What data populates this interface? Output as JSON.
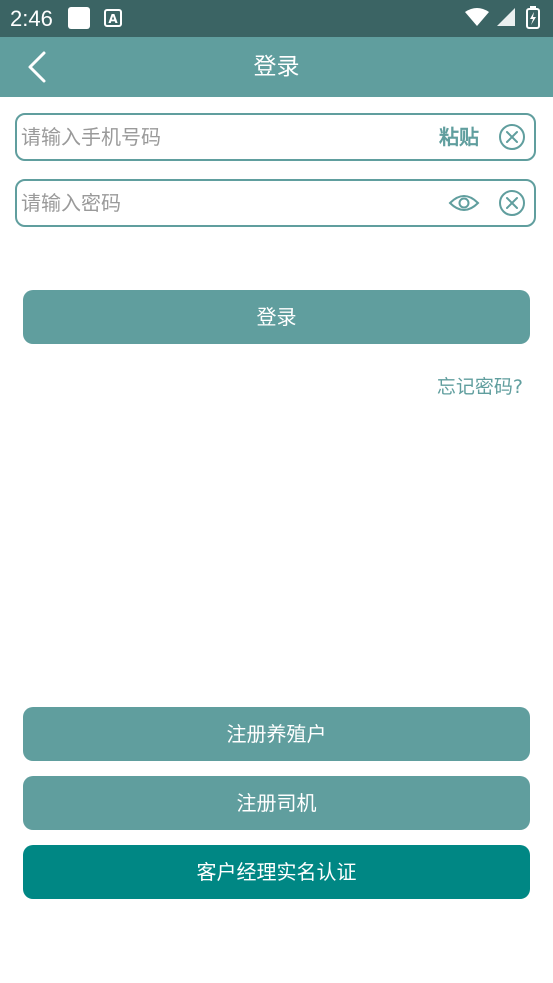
{
  "status_bar": {
    "time": "2:46",
    "icons": [
      "notification-square-icon",
      "a-badge-icon",
      "wifi-icon",
      "signal-icon",
      "battery-charging-icon"
    ],
    "a_badge_letter": "A"
  },
  "app_bar": {
    "title": "登录",
    "back_icon": "chevron-left-icon"
  },
  "phone_field": {
    "value": "",
    "placeholder": "请输入手机号码",
    "paste_label": "粘贴",
    "clear_icon": "clear-circle-icon"
  },
  "password_field": {
    "value": "",
    "placeholder": "请输入密码",
    "eye_icon": "eye-icon",
    "clear_icon": "clear-circle-icon"
  },
  "login_button": {
    "label": "登录"
  },
  "forgot_password": {
    "label": "忘记密码?"
  },
  "bottom_buttons": {
    "register_farmer": "注册养殖户",
    "register_driver": "注册司机",
    "manager_verify": "客户经理实名认证"
  },
  "colors": {
    "status_bar": "#3b6464",
    "primary": "#609e9e",
    "dark_accent": "#008784"
  }
}
